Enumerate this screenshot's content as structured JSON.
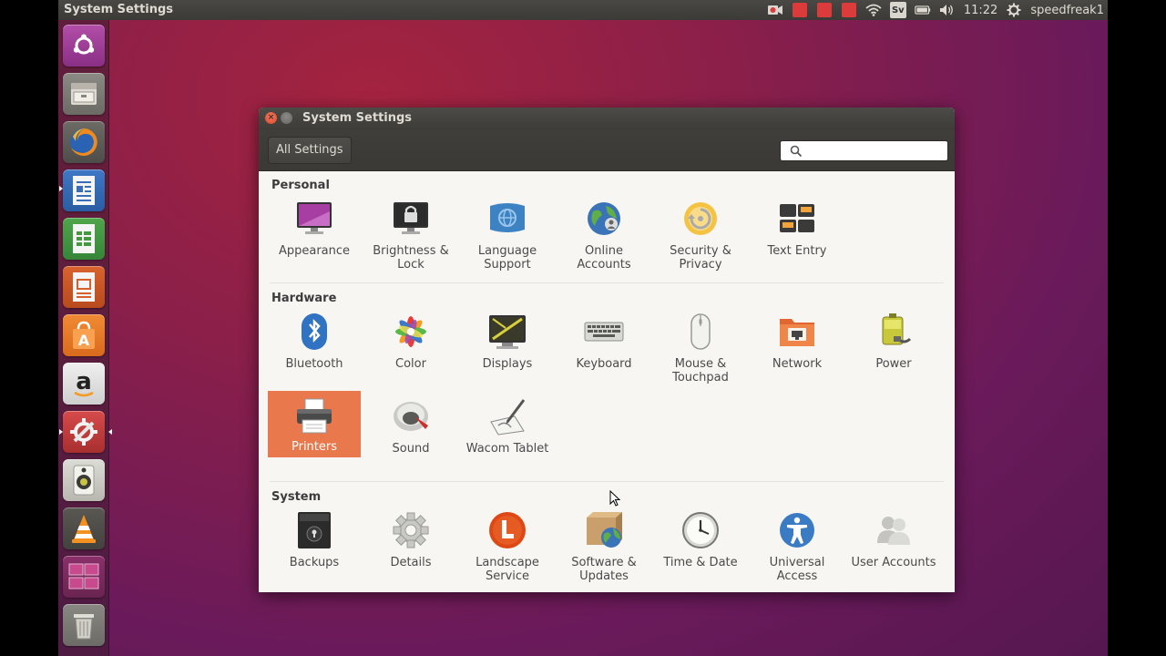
{
  "topbar": {
    "app_title": "System Settings",
    "clock": "11:22",
    "user": "speedfreak1",
    "keyboard_layout": "Sv"
  },
  "launcher": {
    "items": [
      "ubuntu-icon",
      "files-icon",
      "firefox-icon",
      "writer-icon",
      "calc-icon",
      "impress-icon",
      "software-center-icon",
      "amazon-icon",
      "system-settings-icon",
      "speaker-icon",
      "vlc-icon",
      "workspaces-icon",
      "trash-icon"
    ]
  },
  "window": {
    "title": "System Settings",
    "all_settings_label": "All Settings",
    "search_value": "",
    "search_placeholder": ""
  },
  "sections": {
    "personal": {
      "title": "Personal",
      "items": [
        "Appearance",
        "Brightness & Lock",
        "Language Support",
        "Online Accounts",
        "Security & Privacy",
        "Text Entry"
      ]
    },
    "hardware": {
      "title": "Hardware",
      "items": [
        "Bluetooth",
        "Color",
        "Displays",
        "Keyboard",
        "Mouse & Touchpad",
        "Network",
        "Power",
        "Printers",
        "Sound",
        "Wacom Tablet"
      ]
    },
    "system": {
      "title": "System",
      "items": [
        "Backups",
        "Details",
        "Landscape Service",
        "Software & Updates",
        "Time & Date",
        "Universal Access",
        "User Accounts"
      ]
    }
  },
  "selected_item": "Printers",
  "colors": {
    "accent": "#e9784c",
    "panel": "#3c3b37",
    "window_bg": "#f7f6f3"
  }
}
